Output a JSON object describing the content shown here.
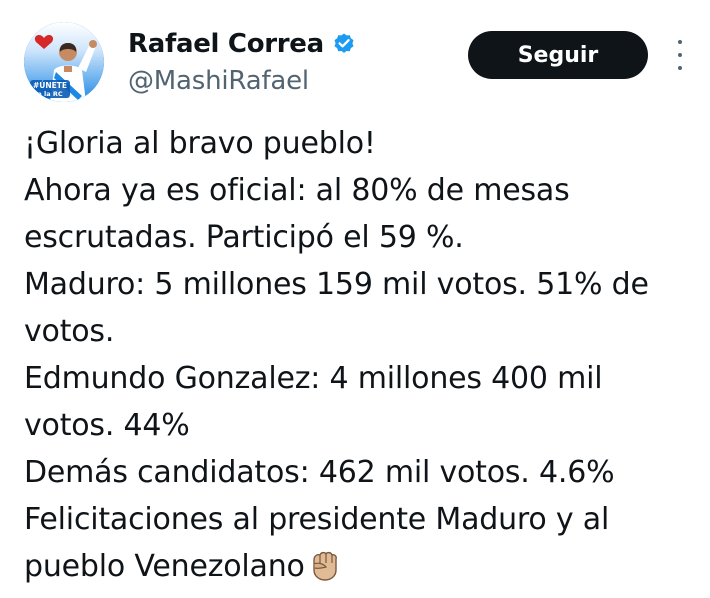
{
  "author": {
    "display_name": "Rafael Correa",
    "handle": "@MashiRafael",
    "verified": true,
    "avatar_text_1": "#ÚNETE",
    "avatar_text_2": "a la RC"
  },
  "actions": {
    "follow_label": "Seguir"
  },
  "tweet": {
    "lines": [
      "¡Gloria al bravo pueblo!",
      "Ahora ya es oficial: al 80% de mesas",
      "escrutadas. Participó el 59 %.",
      "Maduro: 5 millones 159 mil votos. 51% de",
      "votos.",
      "Edmundo Gonzalez: 4 millones 400 mil",
      "votos. 44%",
      "Demás candidatos: 462 mil votos. 4.6%",
      "Felicitaciones al presidente Maduro y al",
      "pueblo Venezolano"
    ],
    "emoji": "raised-fist-medium-light-skin"
  },
  "colors": {
    "text": "#0f1419",
    "secondary_text": "#536471",
    "verified_blue": "#1d9bf0",
    "follow_bg": "#0f1419"
  }
}
